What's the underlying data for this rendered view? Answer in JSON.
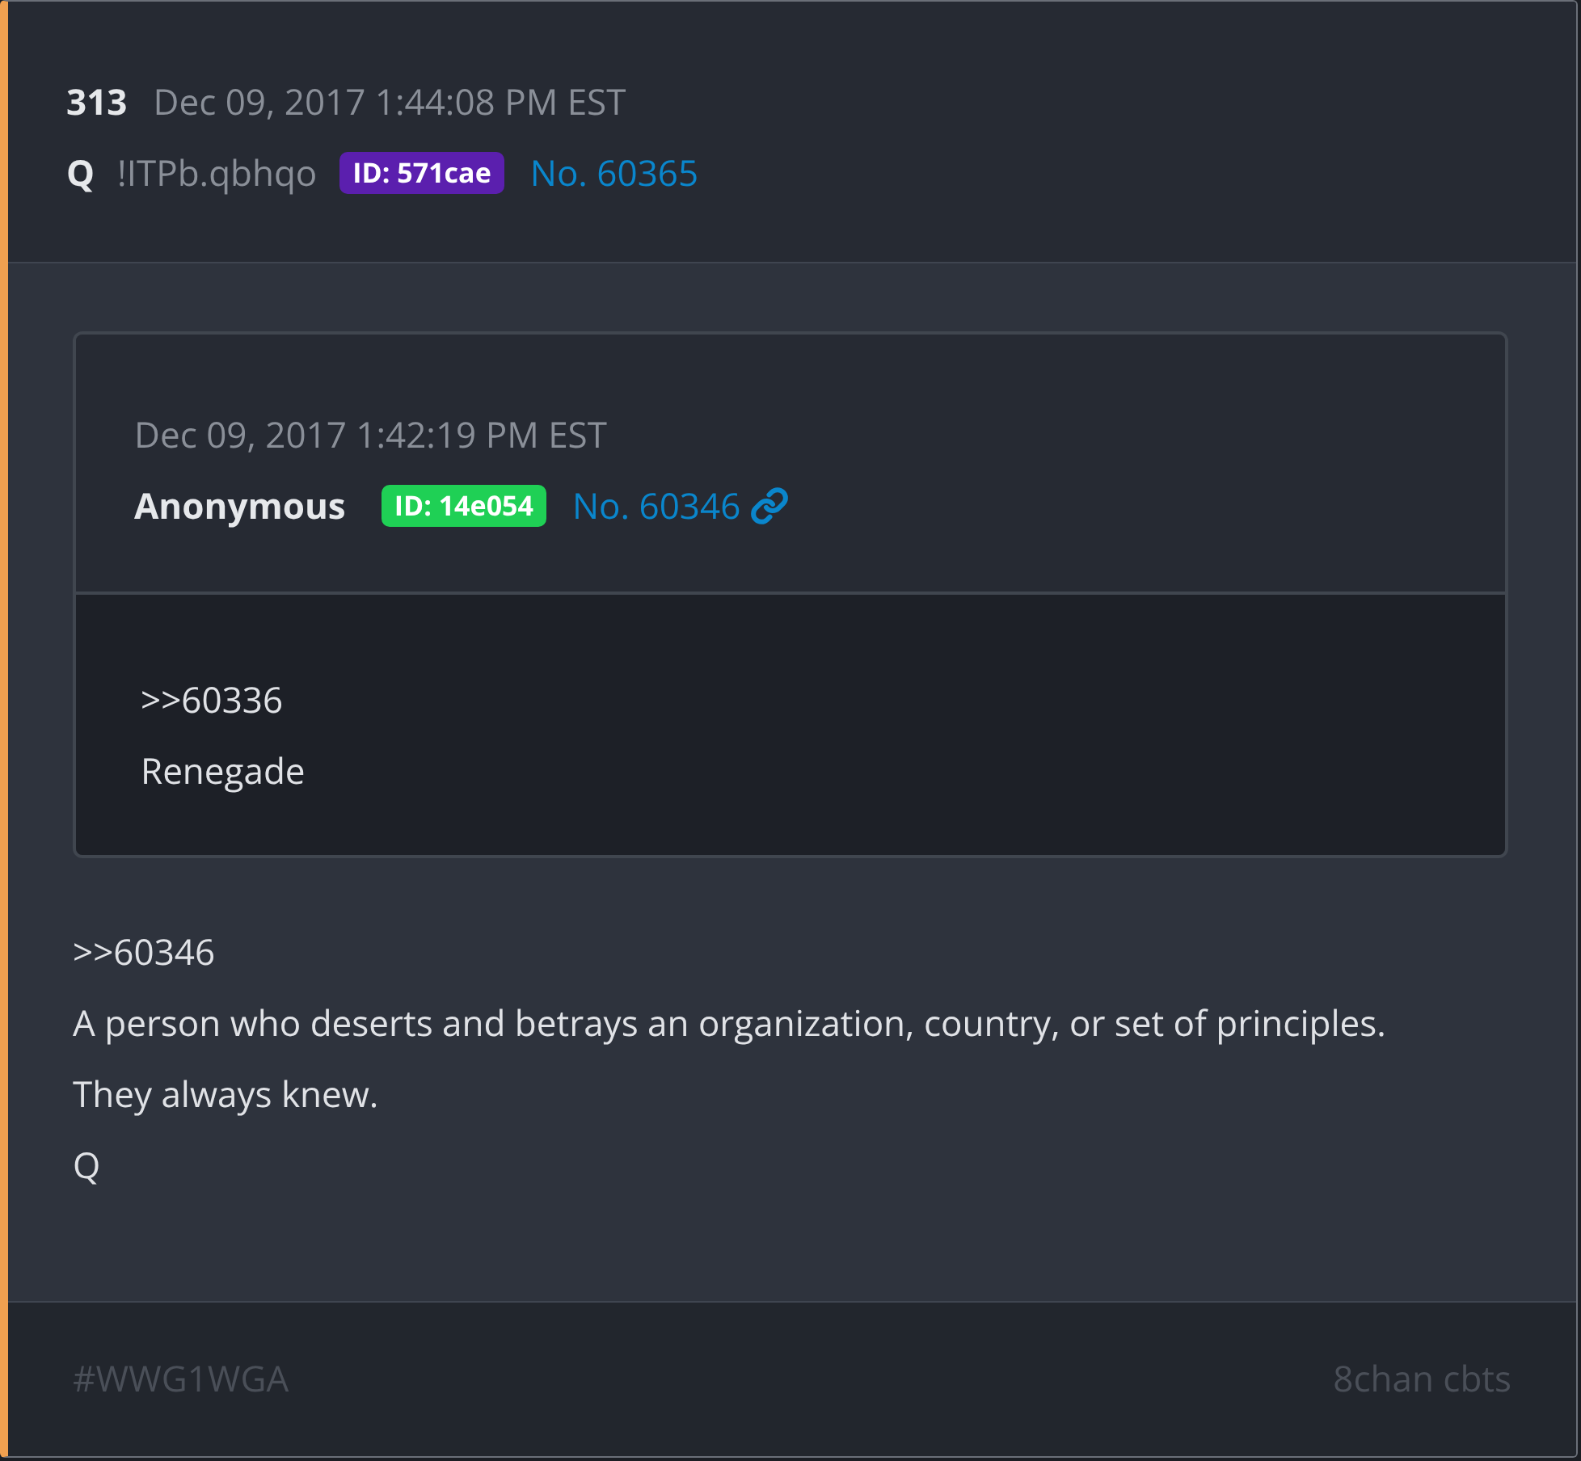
{
  "post": {
    "number": "313",
    "date": "Dec 09, 2017 1:44:08 PM EST",
    "author": "Q",
    "tripcode": "!ITPb.qbhqo",
    "id_badge": "ID: 571cae",
    "post_link": "No. 60365"
  },
  "quoted_post": {
    "date": "Dec 09, 2017 1:42:19 PM EST",
    "author": "Anonymous",
    "id_badge": "ID: 14e054",
    "post_link": "No. 60346",
    "lines": [
      ">>60336",
      "Renegade"
    ]
  },
  "body_lines": [
    ">>60346",
    "A person who deserts and betrays an organization, country, or set of principles.",
    "They always knew.",
    "Q"
  ],
  "footer": {
    "tag": "#WWG1WGA",
    "source": "8chan cbts"
  }
}
